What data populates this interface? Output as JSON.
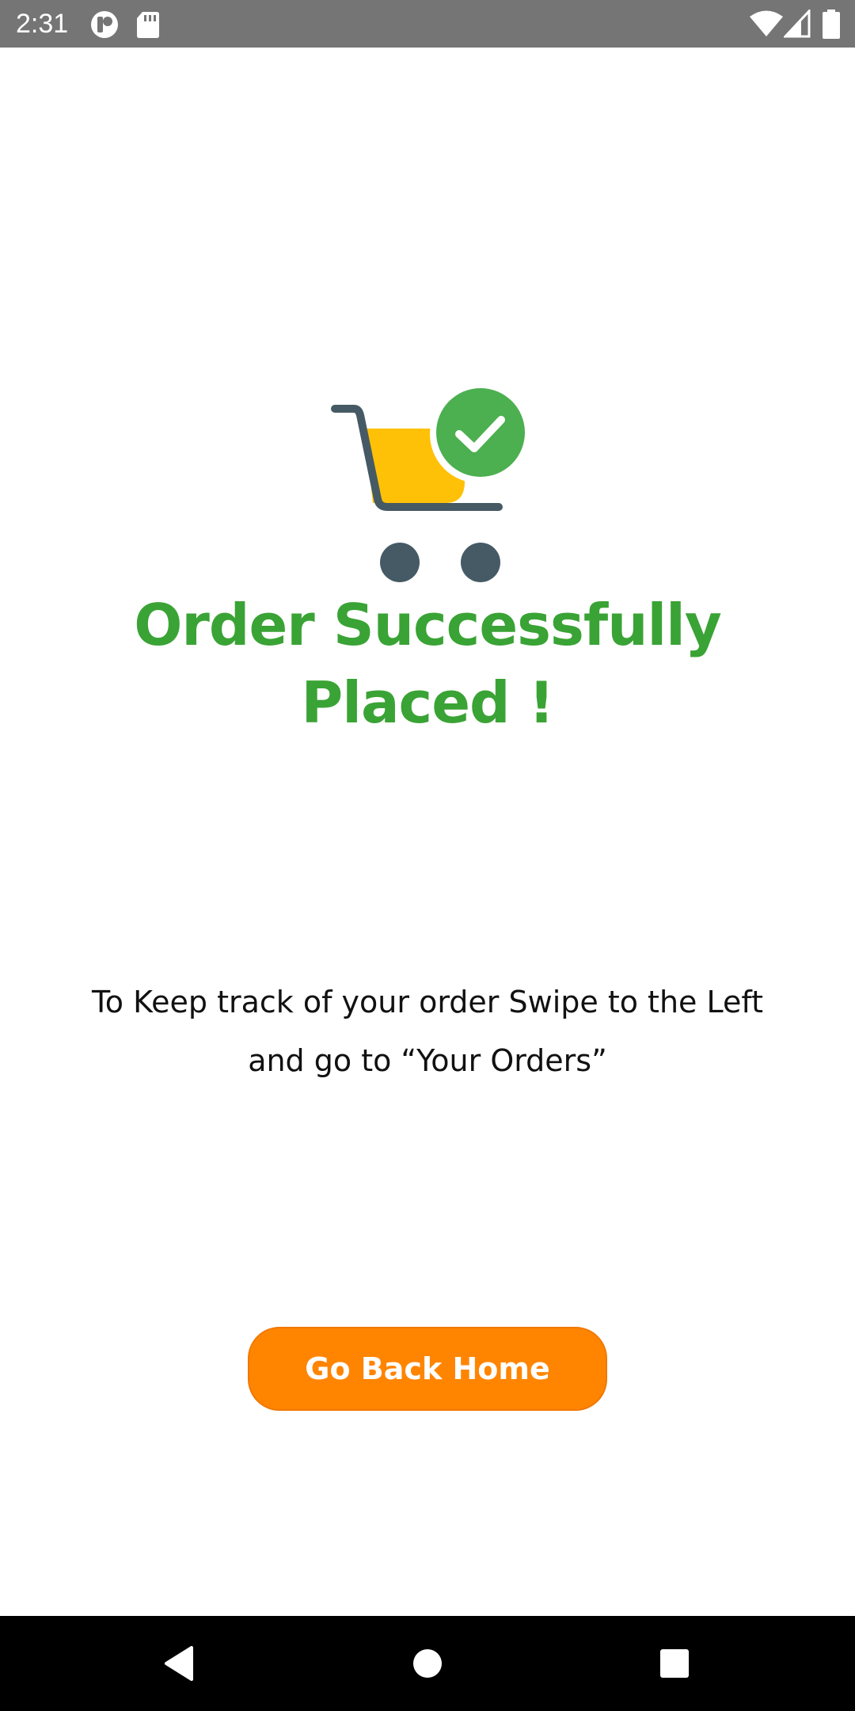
{
  "status_bar": {
    "time": "2:31",
    "background": "#757575",
    "left_icons": [
      "app-notification-icon",
      "sd-card-icon"
    ],
    "right_icons": [
      "wifi-icon",
      "cell-signal-icon",
      "battery-icon"
    ]
  },
  "main": {
    "illustration": "cart-checkmark-icon",
    "title_line1": "Order Successfully",
    "title_line2": "Placed !",
    "title_color": "#3aa335",
    "message_line1": "To Keep track of your order Swipe to the Left",
    "message_line2": "and go to “Your Orders”",
    "button_label": "Go Back Home",
    "button_color": "#ff8500"
  },
  "nav_bar": {
    "buttons": [
      "back-icon",
      "home-icon",
      "recents-icon"
    ]
  }
}
